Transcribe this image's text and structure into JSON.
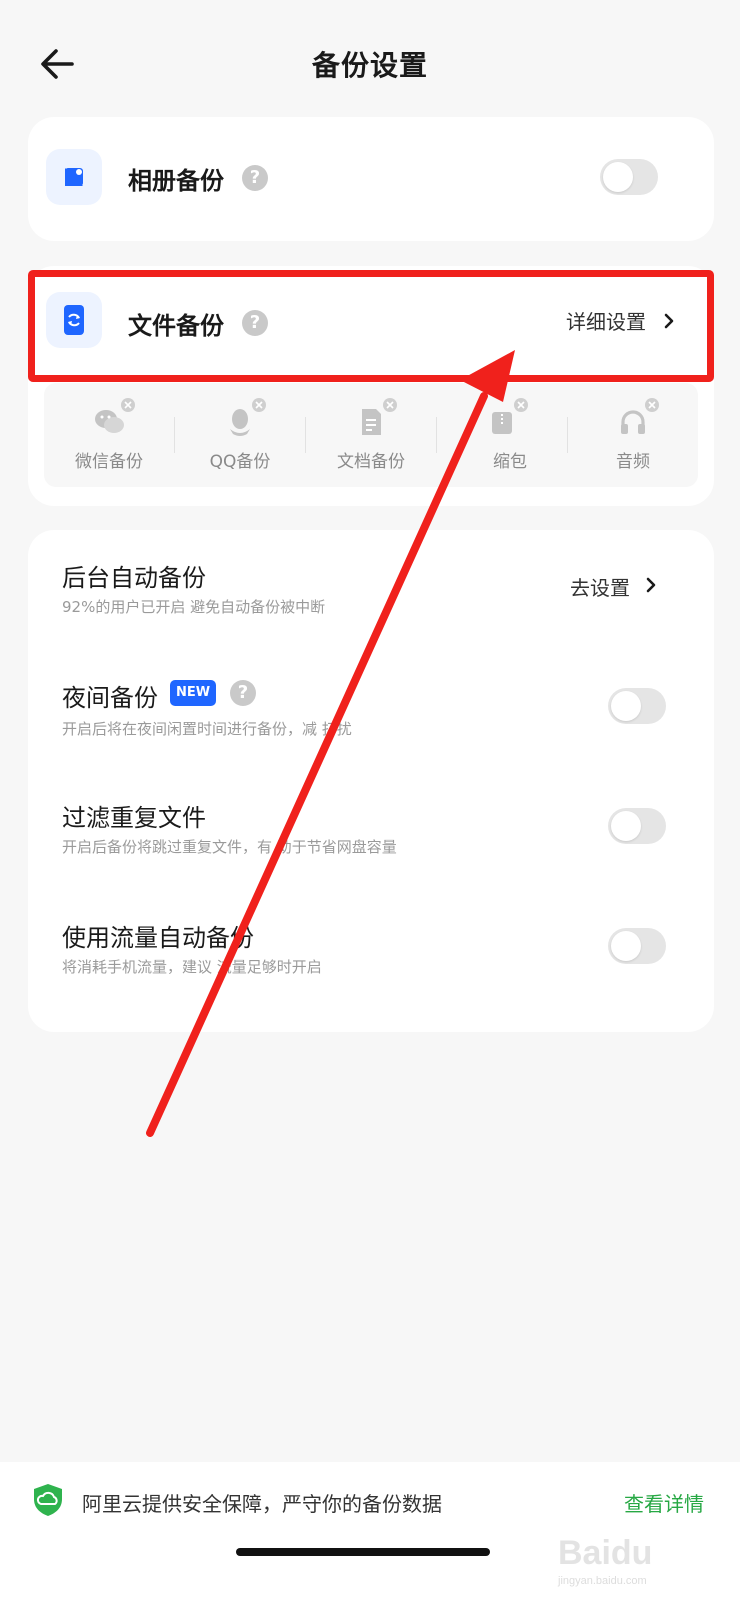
{
  "header": {
    "title": "备份设置",
    "back_icon": "arrow-left-icon"
  },
  "album_backup": {
    "title": "相册备份",
    "icon": "album-icon",
    "help": "?",
    "enabled": false
  },
  "file_backup": {
    "title": "文件备份",
    "icon": "phone-sync-icon",
    "help": "?",
    "link_label": "详细设置",
    "sub_items": [
      {
        "label": "微信备份",
        "icon": "wechat-icon"
      },
      {
        "label": "QQ备份",
        "icon": "qq-icon"
      },
      {
        "label": "文档备份",
        "icon": "document-icon"
      },
      {
        "label": "缩包",
        "icon": "archive-icon"
      },
      {
        "label": "音频",
        "icon": "headphones-icon"
      }
    ]
  },
  "settings": {
    "background_backup": {
      "title": "后台自动备份",
      "desc": "92%的用户已开启 避免自动备份被中断",
      "link_label": "去设置"
    },
    "night_backup": {
      "title": "夜间备份",
      "badge": "NEW",
      "help": "?",
      "desc": "开启后将在夜间闲置时间进行备份，减  打扰",
      "enabled": false
    },
    "filter_duplicates": {
      "title": "过滤重复文件",
      "desc": "开启后备份将跳过重复文件，有  助于节省网盘容量",
      "enabled": false
    },
    "cellular_backup": {
      "title": "使用流量自动备份",
      "desc": "将消耗手机流量，建议  流量足够时开启",
      "enabled": false
    }
  },
  "footer": {
    "icon": "shield-cloud-icon",
    "text": "阿里云提供安全保障，严守你的备份数据",
    "link_label": "查看详情"
  },
  "colors": {
    "accent_blue": "#1f66ff",
    "highlight_red": "#f0211c",
    "link_green": "#27a844"
  }
}
